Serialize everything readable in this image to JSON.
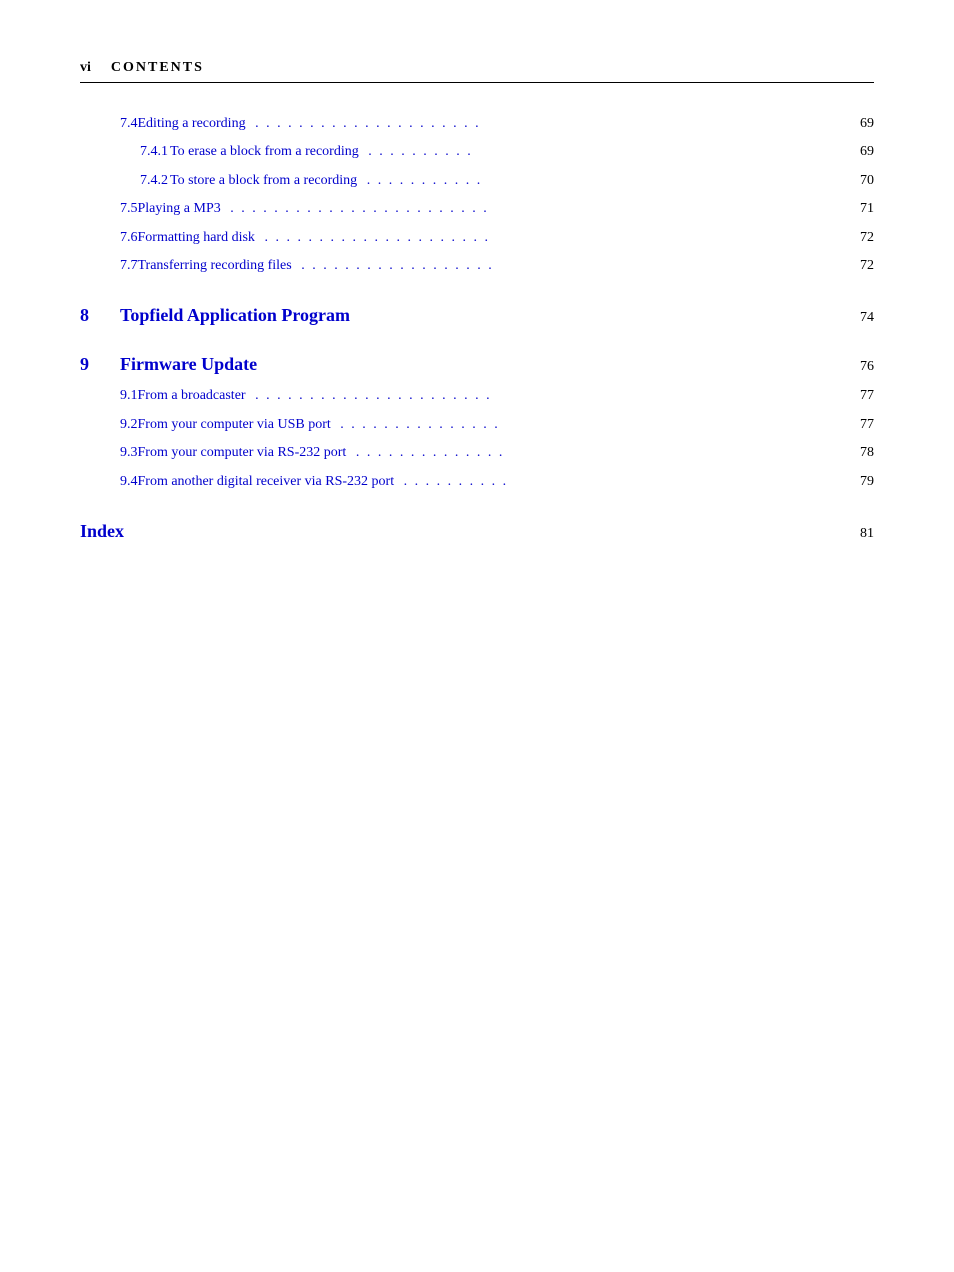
{
  "header": {
    "section_label": "vi",
    "title": "CONTENTS"
  },
  "toc": {
    "sections": [
      {
        "id": "section-7-4",
        "number": "7.4",
        "label": "Editing a recording",
        "dots": true,
        "page": "69",
        "subsections": [
          {
            "id": "section-7-4-1",
            "number": "7.4.1",
            "label": "To erase a block from a recording",
            "dots": true,
            "page": "69"
          },
          {
            "id": "section-7-4-2",
            "number": "7.4.2",
            "label": "To store a block from a recording",
            "dots": true,
            "page": "70"
          }
        ]
      },
      {
        "id": "section-7-5",
        "number": "7.5",
        "label": "Playing a MP3",
        "dots": true,
        "page": "71",
        "subsections": []
      },
      {
        "id": "section-7-6",
        "number": "7.6",
        "label": "Formatting hard disk",
        "dots": true,
        "page": "72",
        "subsections": []
      },
      {
        "id": "section-7-7",
        "number": "7.7",
        "label": "Transferring recording files",
        "dots": true,
        "page": "72",
        "subsections": []
      }
    ],
    "chapter_sections": [
      {
        "id": "chapter-8",
        "number": "8",
        "label": "Topfield Application Program",
        "page": "74",
        "subsections": []
      },
      {
        "id": "chapter-9",
        "number": "9",
        "label": "Firmware Update",
        "page": "76",
        "subsections": [
          {
            "id": "section-9-1",
            "number": "9.1",
            "label": "From a broadcaster",
            "dots": true,
            "page": "77"
          },
          {
            "id": "section-9-2",
            "number": "9.2",
            "label": "From your computer via USB port",
            "dots": true,
            "page": "77"
          },
          {
            "id": "section-9-3",
            "number": "9.3",
            "label": "From your computer via RS-232 port",
            "dots": true,
            "page": "78"
          },
          {
            "id": "section-9-4",
            "number": "9.4",
            "label": "From another digital receiver via RS-232 port",
            "dots": true,
            "page": "79"
          }
        ]
      }
    ],
    "index": {
      "label": "Index",
      "page": "81"
    }
  }
}
